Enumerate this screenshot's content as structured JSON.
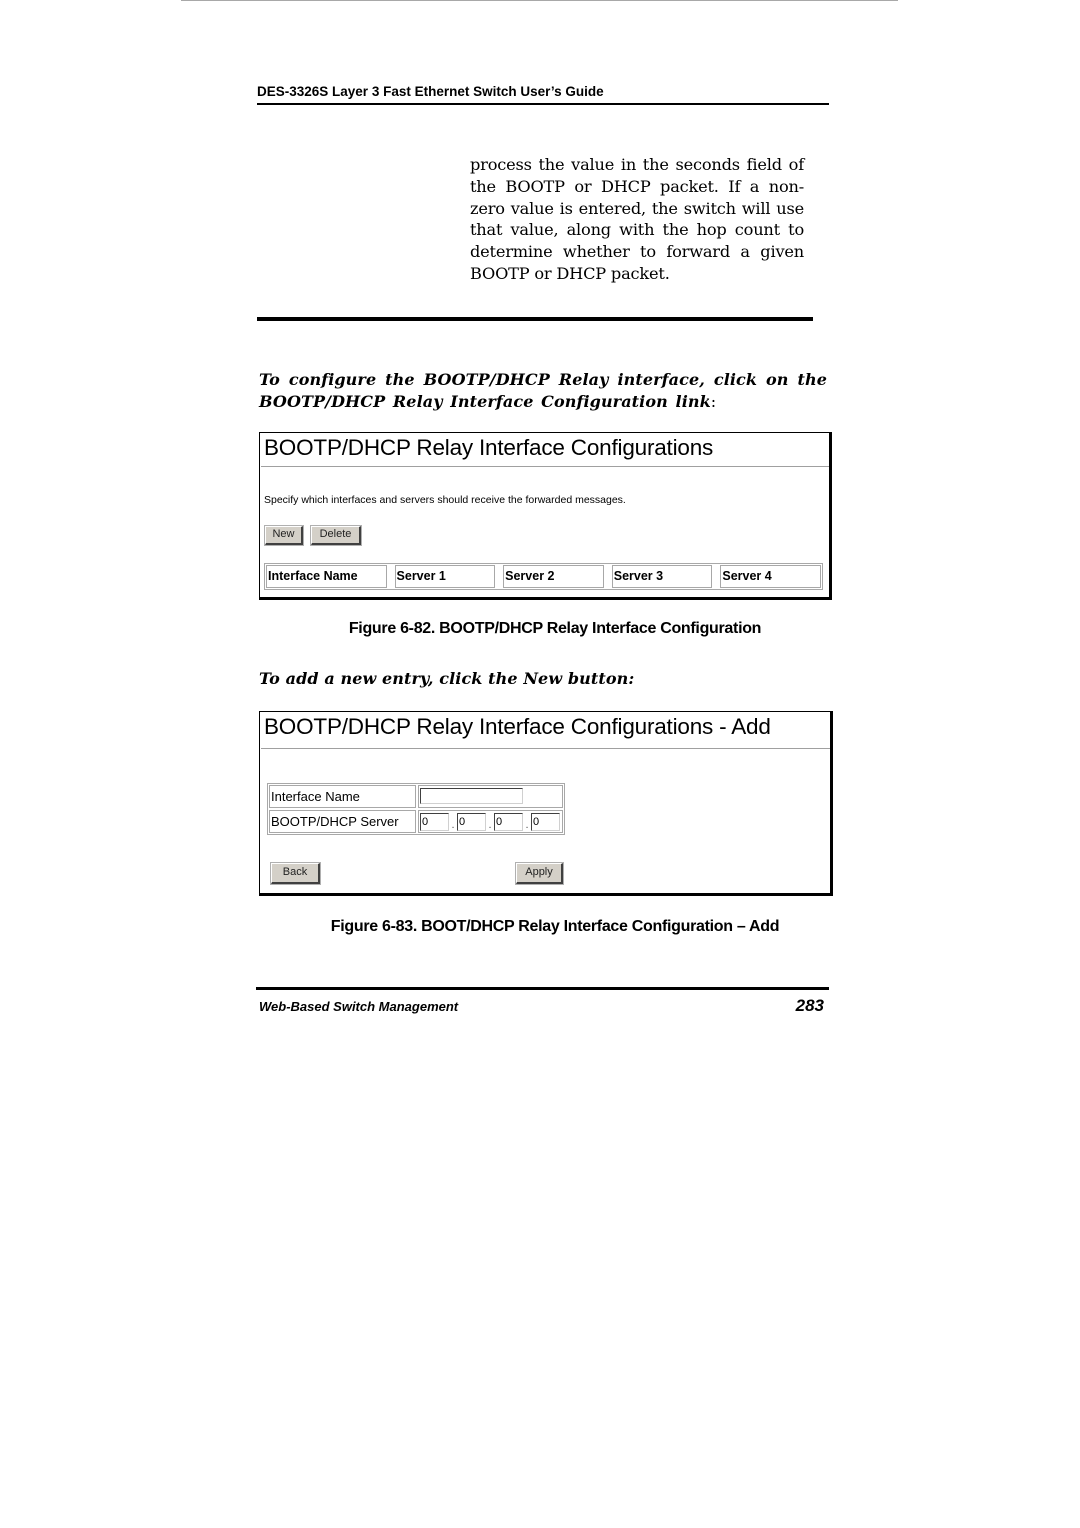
{
  "document": {
    "running_header": "DES-3326S Layer 3 Fast Ethernet Switch User’s Guide",
    "body_paragraph": "process the value in the seconds field of the BOOTP or DHCP packet. If a non-zero value is entered, the switch will use that value, along with the hop count to determine whether to forward a given BOOTP or DHCP packet.",
    "instruction_1": {
      "text": "To configure the BOOTP/DHCP Relay interface, click on the BOOTP/DHCP Relay Interface Configuration link",
      "suffix": ":"
    },
    "instruction_2": "To add a new entry, click the New button:",
    "footer": {
      "section": "Web-Based Switch Management",
      "page_number": "283"
    }
  },
  "figure_82": {
    "caption": "Figure 6-82.  BOOTP/DHCP Relay Interface Configuration",
    "panel": {
      "title": "BOOTP/DHCP Relay Interface Configurations",
      "description": "Specify which interfaces and servers should receive the forwarded messages.",
      "buttons": {
        "new": "New",
        "delete": "Delete"
      },
      "table": {
        "columns": [
          "Interface Name",
          "Server 1",
          "Server 2",
          "Server 3",
          "Server 4"
        ],
        "rows": []
      }
    }
  },
  "figure_83": {
    "caption": "Figure 6-83.  BOOT/DHCP Relay Interface Configuration – Add",
    "panel": {
      "title": "BOOTP/DHCP Relay Interface Configurations - Add",
      "fields": {
        "interface_name": {
          "label": "Interface Name",
          "value": ""
        },
        "server": {
          "label": "BOOTP/DHCP Server",
          "octets": [
            "0",
            "0",
            "0",
            "0"
          ],
          "separator": "."
        }
      },
      "buttons": {
        "back": "Back",
        "apply": "Apply"
      }
    }
  }
}
